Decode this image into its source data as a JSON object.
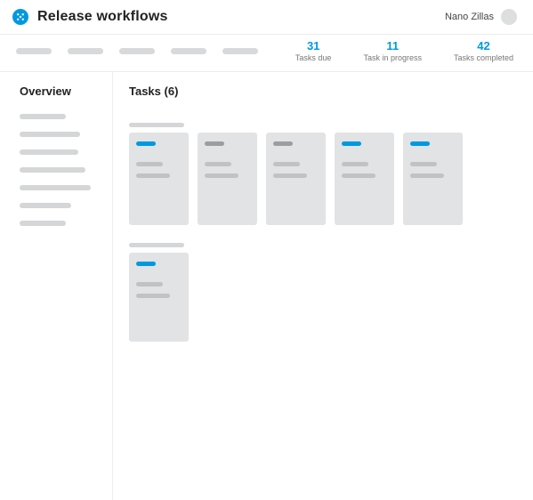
{
  "header": {
    "title": "Release workflows",
    "user_name": "Nano Zillas"
  },
  "stats": [
    {
      "value": "31",
      "label": "Tasks due"
    },
    {
      "value": "11",
      "label": "Task in progress"
    },
    {
      "value": "42",
      "label": "Tasks completed"
    }
  ],
  "nav_pills": 5,
  "sidebar": {
    "title": "Overview",
    "item_widths": [
      52,
      68,
      66,
      74,
      80,
      58,
      52
    ]
  },
  "main": {
    "title": "Tasks (6)",
    "rows": [
      {
        "cards": [
          {
            "status": "active"
          },
          {
            "status": "inactive"
          },
          {
            "status": "inactive"
          },
          {
            "status": "active"
          },
          {
            "status": "active"
          }
        ]
      },
      {
        "cards": [
          {
            "status": "active"
          }
        ]
      }
    ]
  }
}
